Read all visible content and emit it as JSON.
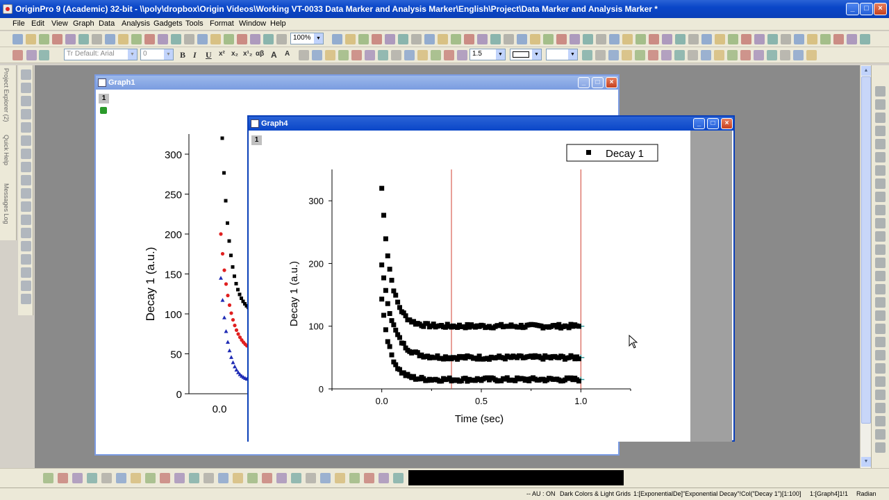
{
  "window": {
    "title": "OriginPro 9 (Academic) 32-bit - \\\\poly\\dropbox\\Origin Videos\\Working VT-0033 Data Marker and Analysis Marker\\English\\Project\\Data Marker and Analysis Marker *",
    "minimize": "_",
    "maximize": "□",
    "close": "×"
  },
  "menu": [
    "File",
    "Edit",
    "View",
    "Graph",
    "Data",
    "Analysis",
    "Gadgets",
    "Tools",
    "Format",
    "Window",
    "Help"
  ],
  "toolbar": {
    "zoom": "100%",
    "font": "Tr Default: Arial",
    "font_size": "0",
    "line_width": "1.5",
    "format_labels": [
      "B",
      "I",
      "U",
      "x²",
      "x₂",
      "x¹₂",
      "αβ",
      "A",
      "A"
    ]
  },
  "left_dock": [
    "Project Explorer (2)",
    "Quick Help",
    "Messages Log"
  ],
  "graph1": {
    "title": "Graph1",
    "layer": "1",
    "ylabel": "Decay 1 (a.u.)",
    "yticks": [
      "300",
      "250",
      "200",
      "150",
      "100",
      "50",
      "0"
    ],
    "xticks": [
      "0.0"
    ],
    "colors": {
      "black": "#000000",
      "red": "#e02020",
      "blue": "#1e2ab4"
    }
  },
  "graph4": {
    "title": "Graph4",
    "layer": "1",
    "legend": "Decay 1",
    "xlabel": "Time (sec)",
    "ylabel": "Decay 1 (a.u.)",
    "xticks": [
      "0.0",
      "0.5",
      "1.0"
    ],
    "yticks": [
      "300",
      "200",
      "100",
      "0"
    ],
    "marker_line_color": "#d04030",
    "marker_point_color": "#2a9a9a"
  },
  "chart_data": {
    "type": "scatter",
    "xlabel": "Time (sec)",
    "ylabel": "Decay 1 (a.u.)",
    "xlim": [
      -0.25,
      1.25
    ],
    "ylim": [
      0,
      350
    ],
    "xticks": [
      0.0,
      0.5,
      1.0
    ],
    "yticks": [
      0,
      100,
      200,
      300
    ],
    "legend": "top-right",
    "vertical_markers": [
      0.35,
      1.0
    ],
    "series": [
      {
        "name": "Decay 1",
        "model": {
          "a": 220,
          "k": 22,
          "c": 100
        }
      },
      {
        "name": "",
        "model": {
          "a": 150,
          "k": 18,
          "c": 50
        }
      },
      {
        "name": "",
        "model": {
          "a": 130,
          "k": 24,
          "c": 15
        }
      }
    ]
  },
  "status": {
    "mode": "-- AU : ON",
    "theme": "Dark Colors & Light Grids",
    "dataset": "1:[ExponentialDe]\"Exponential Decay\"!Col(\"Decay 1\")[1:100]",
    "layer": "1:[Graph4]1!1",
    "angle": "Radian"
  }
}
